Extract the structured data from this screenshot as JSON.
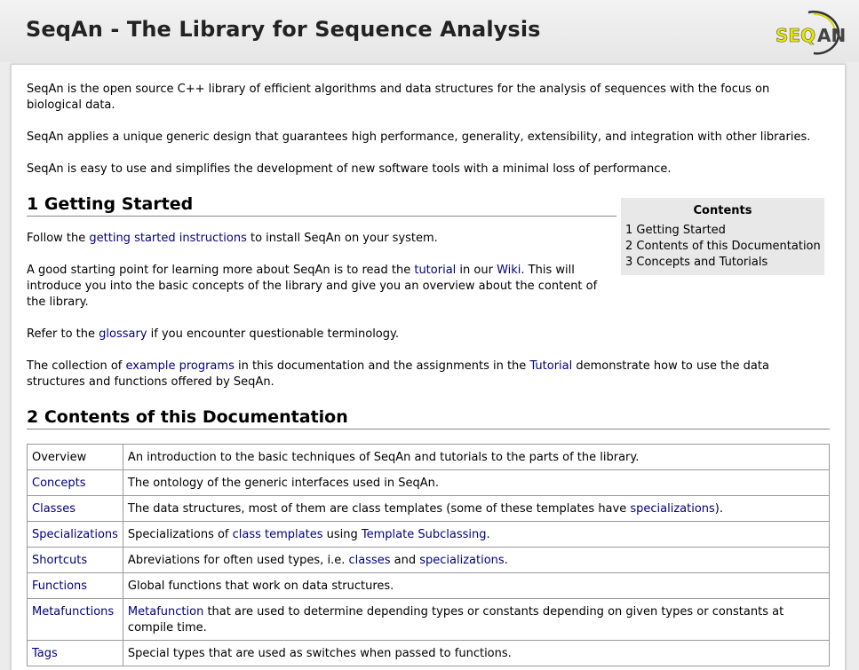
{
  "header": {
    "title": "SeqAn - The Library for Sequence Analysis",
    "logo_text": "SEQAN"
  },
  "intro": {
    "p1": "SeqAn is the open source C++ library of efficient algorithms and data structures for the analysis of sequences with the focus on biological data.",
    "p2": "SeqAn applies a unique generic design that guarantees high performance, generality, extensibility, and integration with other libraries.",
    "p3": "SeqAn is easy to use and simplifies the development of new software tools with a minimal loss of performance."
  },
  "section1": {
    "heading": "1 Getting Started",
    "p1_pre": "Follow the ",
    "p1_link": "getting started instructions",
    "p1_post": " to install SeqAn on your system.",
    "p2_pre": "A good starting point for learning more about SeqAn is to read the ",
    "p2_link1": "tutorial",
    "p2_mid": " in our ",
    "p2_link2": "Wiki",
    "p2_post": ". This will introduce you into the basic concepts of the library and give you an overview about the content of the library.",
    "p3_pre": "Refer to the ",
    "p3_link": "glossary",
    "p3_post": " if you encounter questionable terminology.",
    "p4_pre": "The collection of ",
    "p4_link1": "example programs",
    "p4_mid": " in this documentation and the assignments in the ",
    "p4_link2": "Tutorial",
    "p4_post": " demonstrate how to use the data structures and functions offered by SeqAn."
  },
  "toc": {
    "title": "Contents",
    "items": [
      "1 Getting Started",
      "2 Contents of this Documentation",
      "3 Concepts and Tutorials"
    ]
  },
  "section2": {
    "heading": "2 Contents of this Documentation",
    "rows": [
      {
        "name": "Overview",
        "d1": "An introduction to the basic techniques of SeqAn and tutorials to the parts of the library."
      },
      {
        "name": "Concepts",
        "d1": "The ontology of the generic interfaces used in SeqAn."
      },
      {
        "name": "Classes",
        "d1": "The data structures, most of them are class templates (some of these templates have ",
        "l1": "specializations",
        "d2": ")."
      },
      {
        "name": "Specializations",
        "d1": "Specializations of ",
        "l1": "class templates",
        "d2": " using ",
        "l2": "Template Subclassing",
        "d3": "."
      },
      {
        "name": "Shortcuts",
        "d1": "Abreviations for often used types, i.e. ",
        "l1": "classes",
        "d2": " and ",
        "l2": "specializations",
        "d3": "."
      },
      {
        "name": "Functions",
        "d1": "Global functions that work on data structures."
      },
      {
        "name": "Metafunctions",
        "l1": "Metafunction",
        "d2": " that are used to determine depending types or constants depending on given types or constants at compile time."
      },
      {
        "name": "Tags",
        "d1": "Special types that are used as switches when passed to functions."
      }
    ]
  },
  "colors": {
    "link": "#000080",
    "toc_bg": "#e8e8e8",
    "page_bg": "#ececec"
  }
}
